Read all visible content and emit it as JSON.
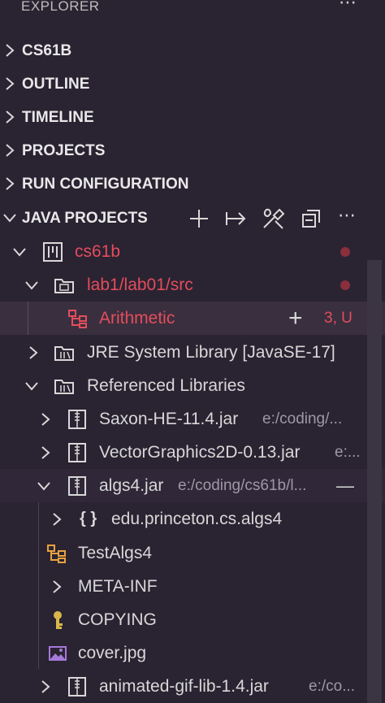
{
  "header": {
    "title": "EXPLORER",
    "more": "⋯"
  },
  "sections": [
    {
      "label": "CS61B",
      "expanded": false
    },
    {
      "label": "OUTLINE",
      "expanded": false
    },
    {
      "label": "TIMELINE",
      "expanded": false
    },
    {
      "label": "PROJECTS",
      "expanded": false
    },
    {
      "label": "RUN CONFIGURATION",
      "expanded": false
    },
    {
      "label": "JAVA PROJECTS",
      "expanded": true
    }
  ],
  "toolbar": {
    "icons": [
      "add-icon",
      "export-jar-icon",
      "build-tools-icon",
      "collapse-all-icon",
      "more-icon"
    ],
    "more": "⋯"
  },
  "tree": {
    "project": {
      "label": "cs61b"
    },
    "source_folder": {
      "label": "lab1/lab01/src"
    },
    "class_item": {
      "label": "Arithmetic",
      "add": "+",
      "badge": "3, U"
    },
    "jre": {
      "label": "JRE System Library [JavaSE-17]"
    },
    "ref_libs": {
      "label": "Referenced Libraries"
    },
    "saxon": {
      "label": "Saxon-HE-11.4.jar",
      "desc": "e:/coding/..."
    },
    "vector": {
      "label": "VectorGraphics2D-0.13.jar",
      "desc": "e:..."
    },
    "algs4": {
      "label": "algs4.jar",
      "desc": "e:/coding/cs61b/l...",
      "action": "—"
    },
    "package": {
      "label": "edu.princeton.cs.algs4",
      "glyph": "{ }"
    },
    "testalgs": {
      "label": "TestAlgs4"
    },
    "metainf": {
      "label": "META-INF"
    },
    "copying": {
      "label": "COPYING"
    },
    "cover": {
      "label": "cover.jpg"
    },
    "animated": {
      "label": "animated-gif-lib-1.4.jar",
      "desc": "e:/co..."
    }
  },
  "colors": {
    "background": "#2a2332",
    "error_red": "#e34d5c",
    "dot_red": "#8a2f3c",
    "selection": "#3a2f3f",
    "description_gray": "#9e98a6"
  }
}
